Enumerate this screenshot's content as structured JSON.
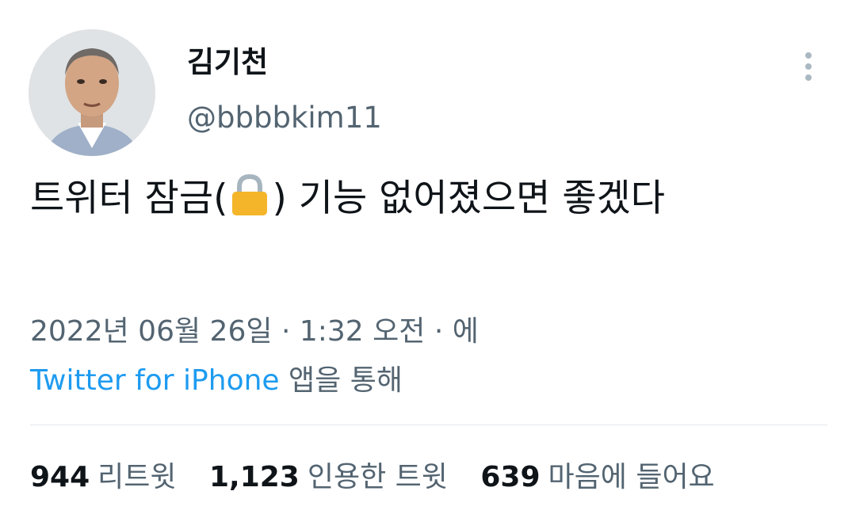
{
  "author": {
    "display_name": "김기천",
    "handle": "@bbbbkim11"
  },
  "tweet": {
    "text_before_icon": "트위터 잠금(",
    "text_after_icon": ") 기능 없어졌으면 좋겠다",
    "inline_icon": "lock-icon",
    "date": "2022년 06월 26일",
    "separator": "·",
    "time": "1:32 오전",
    "via_suffix_pre": "에",
    "source": "Twitter for iPhone",
    "via_suffix_post": "앱을 통해"
  },
  "stats": {
    "retweets_count": "944",
    "retweets_label": "리트윗",
    "quotes_count": "1,123",
    "quotes_label": "인용한 트윗",
    "likes_count": "639",
    "likes_label": "마음에 들어요"
  },
  "icons": {
    "more": "more-vertical-icon",
    "lock": "lock-icon"
  },
  "colors": {
    "text": "#0f1419",
    "secondary": "#536471",
    "link": "#1d9bf0",
    "lock": "#f4b52a"
  }
}
